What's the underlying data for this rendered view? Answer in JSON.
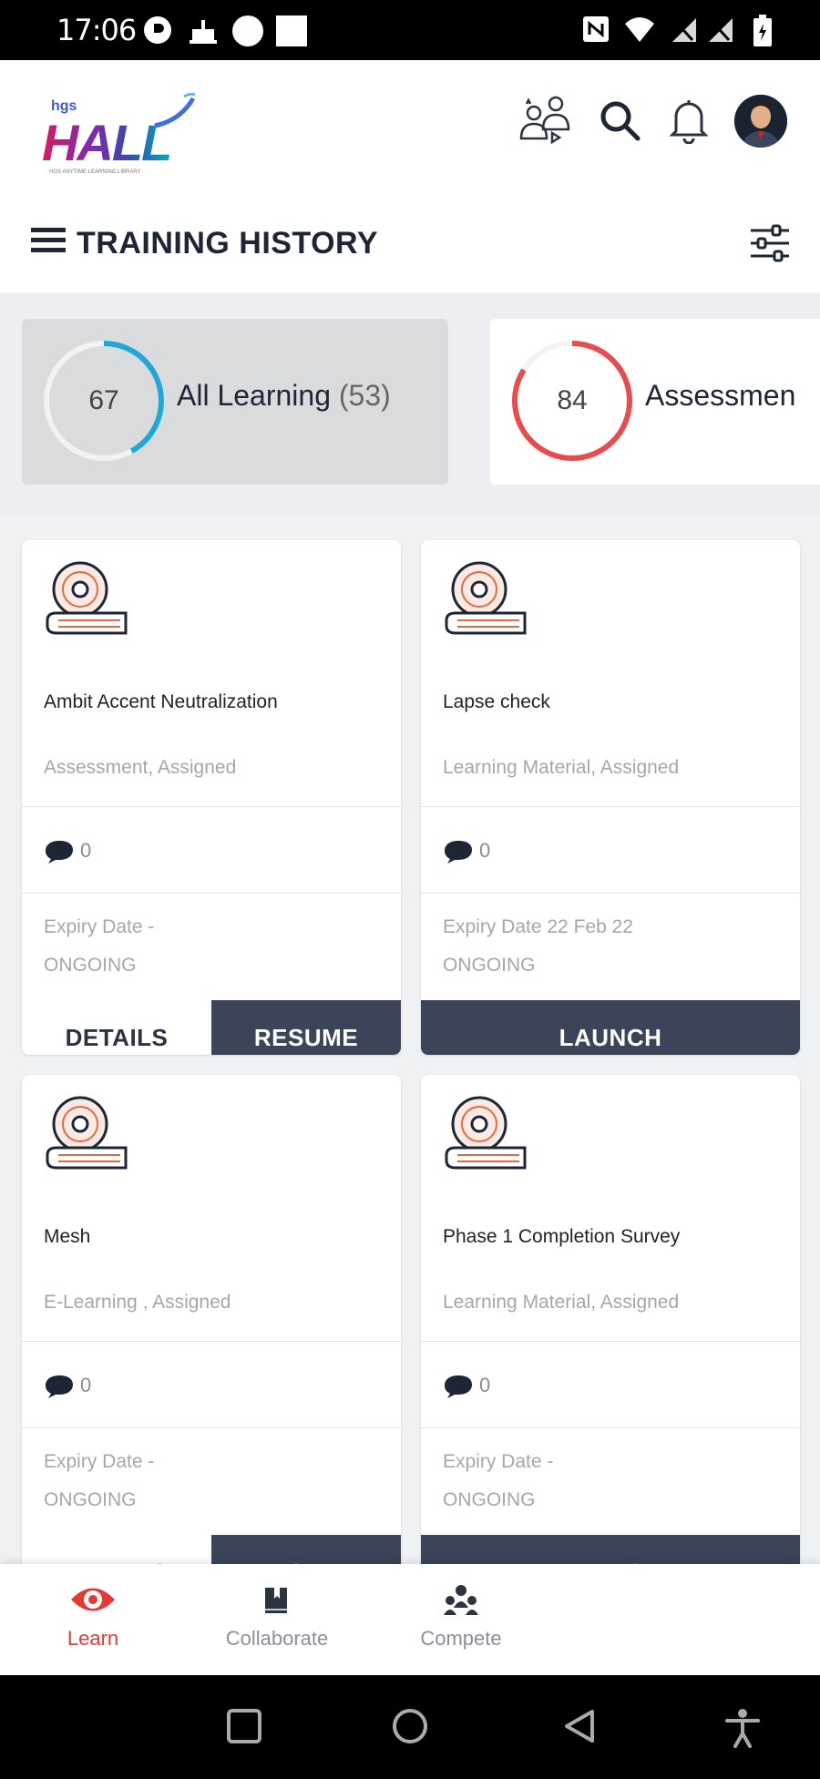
{
  "status_bar": {
    "time": "17:06"
  },
  "header": {
    "logo": {
      "brand": "hgs",
      "name": "HALL",
      "tagline": "HGS ANYTIME LEARNING LIBRARY"
    },
    "page_title": "TRAINING HISTORY"
  },
  "summary": [
    {
      "value": "67",
      "label": "All Learning",
      "count": "(53)",
      "progress": 0.42,
      "color": "#1ea8d8",
      "active": true
    },
    {
      "value": "84",
      "label": "Assessmen",
      "count": "",
      "progress": 0.84,
      "color": "#e84c4c",
      "active": false
    }
  ],
  "cards": [
    {
      "title": "Ambit Accent Neutralization",
      "subtitle": "Assessment, Assigned",
      "comments": "0",
      "expiry_label": "Expiry Date -",
      "status": "ONGOING",
      "buttons": [
        "DETAILS",
        "RESUME"
      ]
    },
    {
      "title": "Lapse check",
      "subtitle": "Learning Material, Assigned",
      "comments": "0",
      "expiry_label": "Expiry Date 22 Feb 22",
      "status": "ONGOING",
      "buttons": [
        "LAUNCH"
      ]
    },
    {
      "title": "Mesh",
      "subtitle": "E-Learning , Assigned",
      "comments": "0",
      "expiry_label": "Expiry Date -",
      "status": "ONGOING",
      "buttons": [
        "DETAILS",
        "RESUME"
      ]
    },
    {
      "title": "Phase 1 Completion Survey",
      "subtitle": "Learning Material, Assigned",
      "comments": "0",
      "expiry_label": "Expiry Date -",
      "status": "ONGOING",
      "buttons": [
        "LAUNCH"
      ]
    }
  ],
  "bottom_nav": [
    {
      "label": "Learn",
      "icon": "eye-icon",
      "active": true
    },
    {
      "label": "Collaborate",
      "icon": "book-icon",
      "active": false
    },
    {
      "label": "Compete",
      "icon": "team-icon",
      "active": false
    }
  ],
  "colors": {
    "accent": "#e53935",
    "button_dark": "#3b4458",
    "ring_blue": "#1ea8d8",
    "ring_red": "#e84c4c"
  }
}
